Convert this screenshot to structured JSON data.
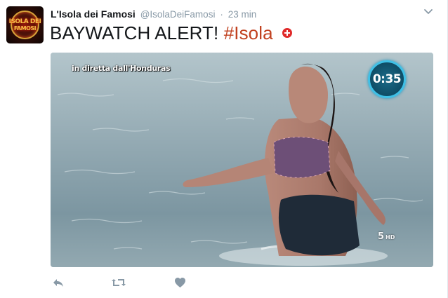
{
  "tweet": {
    "display_name": "L'Isola dei Famosi",
    "handle": "@IsolaDeiFamosi",
    "separator": "·",
    "timestamp": "23 min",
    "text": "BAYWATCH ALERT!",
    "hashtag": "#Isola"
  },
  "avatar": {
    "line1": "ISOLA DEI",
    "line2": "FAMOSI"
  },
  "media": {
    "caption": "in diretta dall'Honduras",
    "timer": "0:35",
    "channel_logo": "5",
    "channel_hd": "HD"
  },
  "colors": {
    "hashtag": "#c1411f",
    "muted": "#8899a6",
    "badge": "#e02a2a",
    "timer_ring": "#3fc0e6"
  },
  "icons": {
    "caret": "chevron-down-icon",
    "reply": "reply-icon",
    "retweet": "retweet-icon",
    "like": "heart-icon"
  }
}
